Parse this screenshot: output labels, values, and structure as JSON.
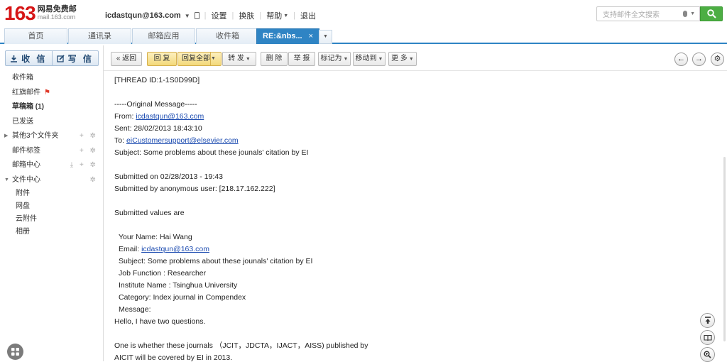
{
  "header": {
    "logo_number": "163",
    "logo_title": "网易免费邮",
    "logo_domain": "mail.163.com",
    "user_email": "icdastqun@163.com",
    "links": [
      "设置",
      "换肤",
      "帮助",
      "退出"
    ],
    "search_placeholder": "支持邮件全文搜索"
  },
  "tabs": [
    {
      "label": "首页",
      "active": false
    },
    {
      "label": "通讯录",
      "active": false
    },
    {
      "label": "邮箱应用",
      "active": false
    },
    {
      "label": "收件箱",
      "active": false
    },
    {
      "label": "RE:&nbs...",
      "active": true,
      "close": "×"
    }
  ],
  "sidebar": {
    "receive_label": "收 信",
    "write_label": "写 信",
    "items": [
      {
        "label": "收件箱"
      },
      {
        "label": "红旗邮件"
      },
      {
        "label": "草稿箱 (1)"
      },
      {
        "label": "已发送"
      },
      {
        "label": "其他3个文件夹"
      },
      {
        "label": "邮件标签"
      },
      {
        "label": "邮箱中心"
      },
      {
        "label": "文件中心"
      }
    ],
    "sub_items": [
      {
        "label": "附件"
      },
      {
        "label": "网盘"
      },
      {
        "label": "云附件"
      },
      {
        "label": "相册"
      }
    ]
  },
  "toolbar": {
    "back": "« 返回",
    "reply": "回 复",
    "reply_all": "回复全部",
    "forward": "转 发",
    "delete": "删 除",
    "report": "举 报",
    "mark_as": "标记为",
    "move_to": "移动到",
    "more": "更 多"
  },
  "message": {
    "thread_id": "[THREAD ID:1-1S0D99D]",
    "orig_header": "-----Original Message-----",
    "from_label": "From: ",
    "from": "icdastqun@163.com",
    "sent": "Sent: 28/02/2013 18:43:10",
    "to_label": "To: ",
    "to": "eiCustomersupport@elsevier.com",
    "subject": "Subject: Some problems about these jounals' citation by EI",
    "submitted_on": "Submitted on 02/28/2013 - 19:43",
    "submitted_by": "Submitted by anonymous user: [218.17.162.222]",
    "submitted_values": "Submitted values are",
    "your_name": "Your Name: Hai Wang",
    "email_label": "Email: ",
    "email": "icdastqun@163.com",
    "subject2": "Subject: Some problems about these jounals' citation by EI",
    "job": "Job Function : Researcher",
    "institute": "Institute Name : Tsinghua University",
    "category": "Category: Index journal in Compendex",
    "message_label": "Message:",
    "hello": "Hello, I have two questions.",
    "p1": "One is whether these journals （JCIT，JDCTA，IJACT，AISS) published by",
    "p2": "AICIT will be covered by EI in 2013."
  }
}
